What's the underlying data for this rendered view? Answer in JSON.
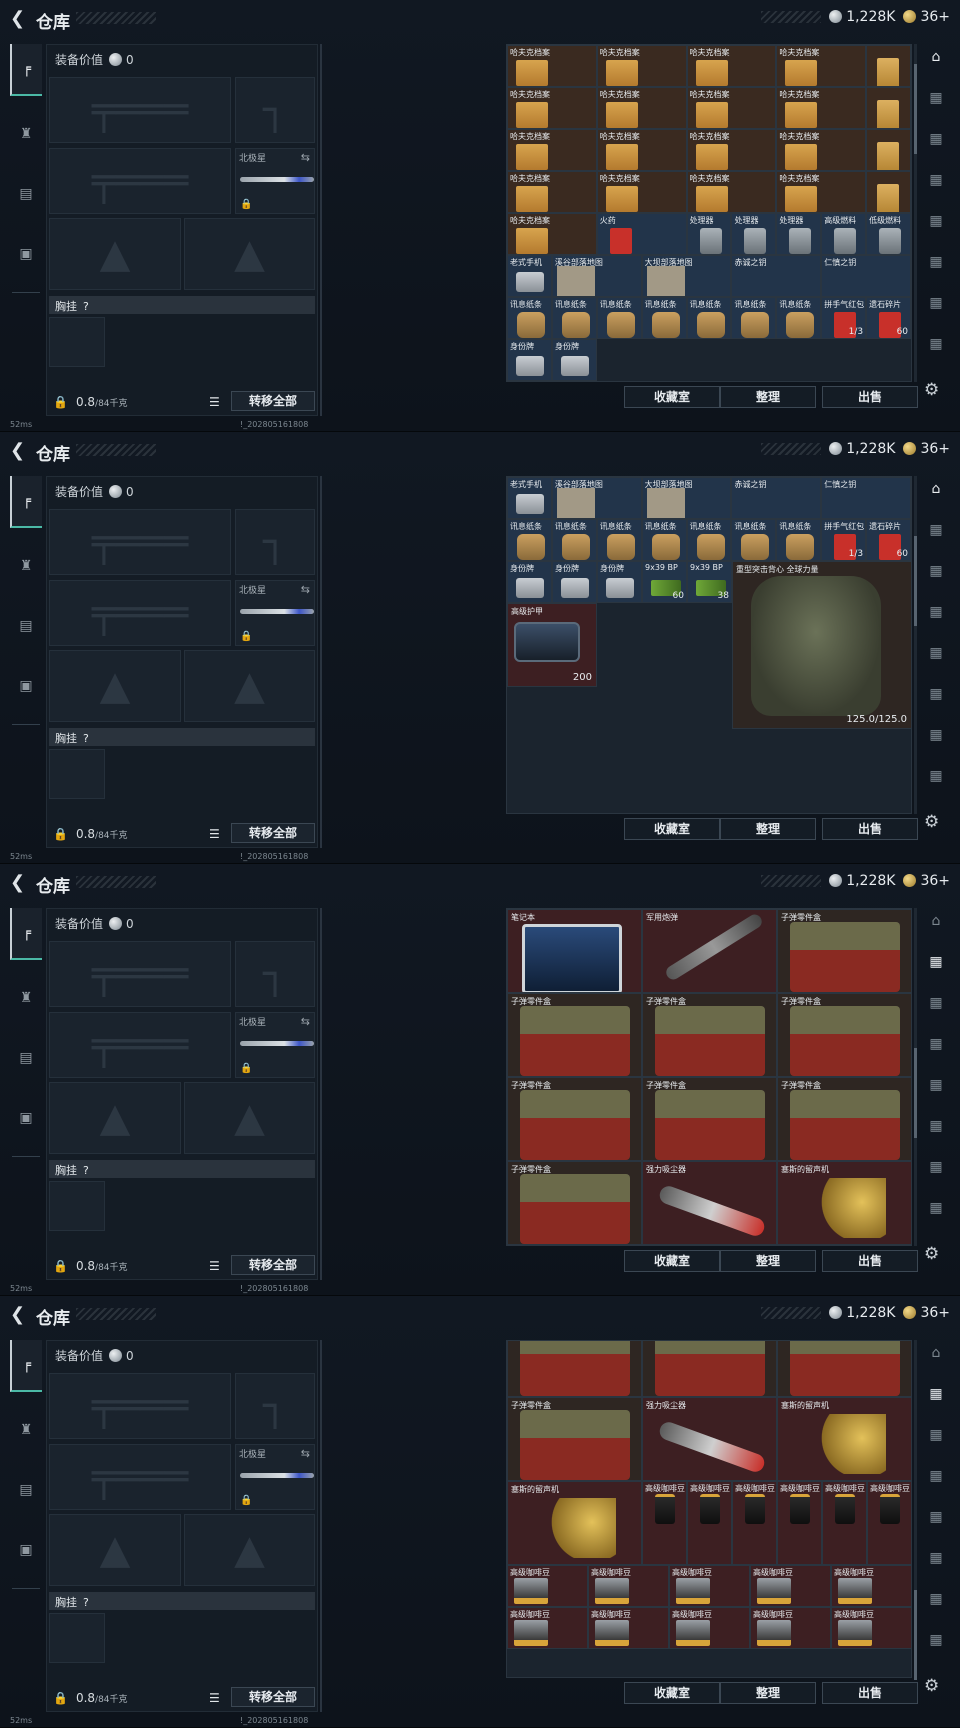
{
  "header": {
    "title": "仓库",
    "back_icon": "back-chevron-icon",
    "silver": "1,228K",
    "gold": "36+"
  },
  "equipment": {
    "value_label": "装备价值",
    "value": "0",
    "melee_label": "北极星",
    "chest_label": "胸挂",
    "chest_hint": "?",
    "weight": "0.8",
    "weight_unit": "/84千克",
    "transfer_all": "转移全部"
  },
  "actions": {
    "collection": "收藏室",
    "sort": "整理",
    "sell": "出售"
  },
  "status": {
    "ping": "52ms",
    "build": "!_202805161808"
  },
  "panel1": {
    "rows": [
      [
        {
          "n": "哈夫克档案",
          "k": "doc"
        },
        {
          "n": "哈夫克档案",
          "k": "doc"
        },
        {
          "n": "哈夫克档案",
          "k": "doc"
        },
        {
          "n": "哈夫克档案",
          "k": "doc"
        }
      ],
      [
        {
          "n": "哈夫克档案",
          "k": "doc"
        },
        {
          "n": "哈夫克档案",
          "k": "doc"
        },
        {
          "n": "哈夫克档案",
          "k": "doc"
        },
        {
          "n": "哈夫克档案",
          "k": "doc"
        }
      ],
      [
        {
          "n": "哈夫克档案",
          "k": "doc"
        },
        {
          "n": "哈夫克档案",
          "k": "doc"
        },
        {
          "n": "哈夫克档案",
          "k": "doc"
        },
        {
          "n": "哈夫克档案",
          "k": "doc"
        }
      ],
      [
        {
          "n": "哈夫克档案",
          "k": "doc"
        },
        {
          "n": "哈夫克档案",
          "k": "doc"
        },
        {
          "n": "哈夫克档案",
          "k": "doc"
        },
        {
          "n": "哈夫克档案",
          "k": "doc"
        }
      ],
      [
        {
          "n": "哈夫克档案",
          "k": "doc"
        },
        {
          "n": "火药",
          "k": "redbox"
        },
        {
          "n": "处理器",
          "k": "can"
        },
        {
          "n": "处理器",
          "k": "can"
        },
        {
          "n": "处理器",
          "k": "can"
        },
        {
          "n": "高级燃料",
          "k": "can"
        },
        {
          "n": "低级燃料",
          "k": "can"
        }
      ],
      [
        {
          "n": "老式手机",
          "k": "tag"
        },
        {
          "n": "溪谷部落地图",
          "k": "map"
        },
        {
          "n": "大坝部落地图",
          "k": "map"
        },
        {
          "n": "赤诚之钥",
          "k": "key"
        },
        {
          "n": "仁慎之钥",
          "k": "key"
        }
      ],
      [
        {
          "n": "讯息纸条",
          "k": "pouch"
        },
        {
          "n": "讯息纸条",
          "k": "pouch"
        },
        {
          "n": "讯息纸条",
          "k": "pouch"
        },
        {
          "n": "讯息纸条",
          "k": "pouch"
        },
        {
          "n": "讯息纸条",
          "k": "pouch"
        },
        {
          "n": "讯息纸条",
          "k": "pouch"
        },
        {
          "n": "讯息纸条",
          "k": "pouch"
        },
        {
          "n": "拼手气红包",
          "k": "redbox",
          "c": "1/3"
        },
        {
          "n": "遗石碎片",
          "k": "redbox",
          "c": "60"
        }
      ],
      [
        {
          "n": "身份牌",
          "k": "tag"
        },
        {
          "n": "身份牌",
          "k": "tag"
        }
      ]
    ],
    "side_doc_label": "哈夫克档案"
  },
  "panel2": {
    "rows": [
      [
        {
          "n": "老式手机",
          "k": "tag"
        },
        {
          "n": "溪谷部落地图",
          "k": "map"
        },
        {
          "n": "大坝部落地图",
          "k": "map"
        },
        {
          "n": "赤诚之钥",
          "k": "key"
        },
        {
          "n": "仁慎之钥",
          "k": "key"
        }
      ],
      [
        {
          "n": "讯息纸条",
          "k": "pouch"
        },
        {
          "n": "讯息纸条",
          "k": "pouch"
        },
        {
          "n": "讯息纸条",
          "k": "pouch"
        },
        {
          "n": "讯息纸条",
          "k": "pouch"
        },
        {
          "n": "讯息纸条",
          "k": "pouch"
        },
        {
          "n": "讯息纸条",
          "k": "pouch"
        },
        {
          "n": "讯息纸条",
          "k": "pouch"
        },
        {
          "n": "拼手气红包",
          "k": "redbox",
          "c": "1/3"
        },
        {
          "n": "遗石碎片",
          "k": "redbox",
          "c": "60"
        }
      ],
      [
        {
          "n": "身份牌",
          "k": "tag"
        },
        {
          "n": "身份牌",
          "k": "tag"
        },
        {
          "n": "身份牌",
          "k": "tag"
        },
        {
          "n": "9x39 BP",
          "k": "ammo",
          "c": "60"
        },
        {
          "n": "9x39 BP",
          "k": "ammo",
          "c": "38"
        }
      ]
    ],
    "case": {
      "name": "高级护甲",
      "count": "200"
    },
    "vest": {
      "name": "重型突击背心\n全球力量",
      "durability": "125.0/125.0"
    }
  },
  "panel3": {
    "items": [
      {
        "n": "笔记本",
        "k": "laptop"
      },
      {
        "n": "军用炮弹",
        "k": "grenade"
      },
      {
        "n": "子弹零件盒",
        "k": "parts"
      },
      {
        "n": "子弹零件盒",
        "k": "parts"
      },
      {
        "n": "子弹零件盒",
        "k": "parts"
      },
      {
        "n": "子弹零件盒",
        "k": "parts"
      },
      {
        "n": "子弹零件盒",
        "k": "parts"
      },
      {
        "n": "子弹零件盒",
        "k": "parts"
      },
      {
        "n": "子弹零件盒",
        "k": "parts"
      },
      {
        "n": "子弹零件盒",
        "k": "parts"
      },
      {
        "n": "强力吸尘器",
        "k": "vacuum"
      },
      {
        "n": "塞斯的留声机",
        "k": "gramo"
      }
    ]
  },
  "panel4": {
    "items": [
      {
        "n": "",
        "k": "parts"
      },
      {
        "n": "",
        "k": "parts"
      },
      {
        "n": "",
        "k": "parts"
      },
      {
        "n": "子弹零件盒",
        "k": "parts"
      },
      {
        "n": "强力吸尘器",
        "k": "vacuum"
      },
      {
        "n": "塞斯的留声机",
        "k": "gramo"
      }
    ],
    "gramo2": "塞斯的留声机",
    "coffee_tall": [
      "高级咖啡豆",
      "高级咖啡豆",
      "高级咖啡豆",
      "高级咖啡豆",
      "高级咖啡豆",
      "高级咖啡豆"
    ],
    "coffee_boxes": [
      "高级咖啡豆",
      "高级咖啡豆",
      "高级咖啡豆",
      "高级咖啡豆",
      "高级咖啡豆",
      "高级咖啡豆",
      "高级咖啡豆",
      "高级咖啡豆",
      "高级咖啡豆",
      "高级咖啡豆"
    ]
  },
  "colors": {
    "accent": "#4bb9a6",
    "slot_bg": "#1a232d"
  }
}
